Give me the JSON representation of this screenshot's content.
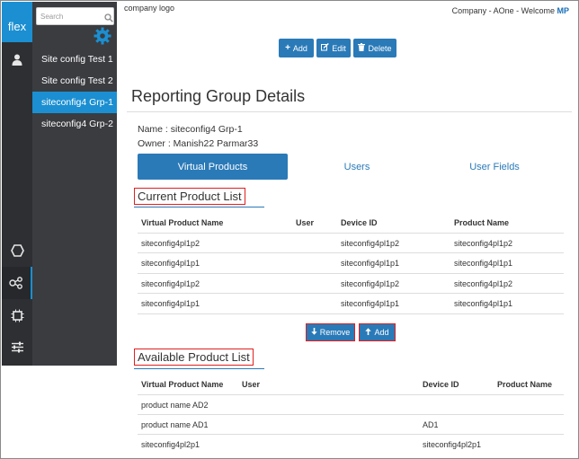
{
  "sidebar": {
    "brand": "flex",
    "search_placeholder": "Search",
    "sites": [
      "Site config Test 1",
      "Site config Test 2",
      "siteconfig4 Grp-1",
      "siteconfig4 Grp-2"
    ],
    "active_site_index": 2
  },
  "header": {
    "logo": "company logo",
    "welcome": "Company - AOne - Welcome ",
    "user_initials": "MP"
  },
  "toolbar": {
    "add": "Add",
    "edit": "Edit",
    "delete": "Delete"
  },
  "page": {
    "title": "Reporting Group Details",
    "name_line": "Name : siteconfig4 Grp-1",
    "owner_line": "Owner : Manish22 Parmar33"
  },
  "tabs": [
    "Virtual Products",
    "Users",
    "User Fields"
  ],
  "current": {
    "heading": "Current Product List",
    "columns": [
      "Virtual Product Name",
      "User",
      "Device ID",
      "Product Name"
    ],
    "rows": [
      [
        "siteconfig4pl1p2",
        "",
        "siteconfig4pl1p2",
        "siteconfig4pl1p2"
      ],
      [
        "siteconfig4pl1p1",
        "",
        "siteconfig4pl1p1",
        "siteconfig4pl1p1"
      ],
      [
        "siteconfig4pl1p2",
        "",
        "siteconfig4pl1p2",
        "siteconfig4pl1p2"
      ],
      [
        "siteconfig4pl1p1",
        "",
        "siteconfig4pl1p1",
        "siteconfig4pl1p1"
      ]
    ],
    "remove_label": "Remove",
    "add_label": "Add"
  },
  "available": {
    "heading": "Available Product List",
    "columns": [
      "Virtual Product Name",
      "User",
      "Device ID",
      "Product Name"
    ],
    "rows": [
      [
        "product name AD2",
        "",
        "",
        ""
      ],
      [
        "product name AD1",
        "",
        "AD1",
        ""
      ],
      [
        "siteconfig4pl2p1",
        "",
        "siteconfig4pl2p1",
        ""
      ]
    ]
  },
  "colors": {
    "accent": "#2a7ab8",
    "brand": "#1b8fd1",
    "rail": "#2d2f33",
    "panel": "#3a3c40",
    "highlight_border": "#e02020"
  }
}
